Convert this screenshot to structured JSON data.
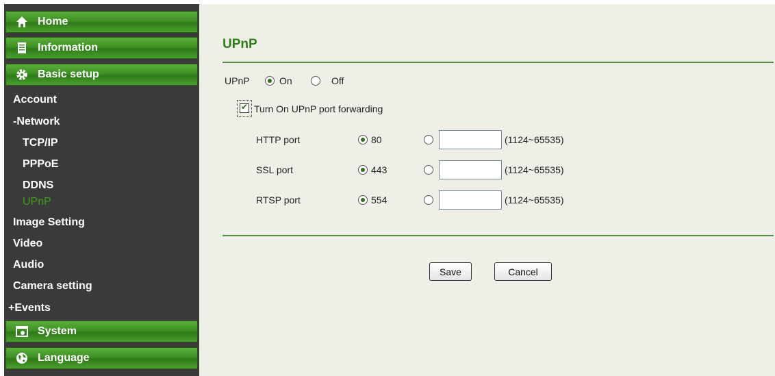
{
  "sidebar": {
    "home": "Home",
    "information": "Information",
    "basic_setup": "Basic setup",
    "items": {
      "account": "Account",
      "network": "-Network",
      "tcpip": "TCP/IP",
      "pppoe": "PPPoE",
      "ddns": "DDNS",
      "upnp": "UPnP",
      "image_setting": "Image Setting",
      "video": "Video",
      "audio": "Audio",
      "camera_setting": "Camera setting",
      "events": "+Events"
    },
    "system": "System",
    "language": "Language",
    "icons": {
      "home": "home-icon",
      "information": "document-icon",
      "basic_setup": "gear-icon",
      "system": "window-icon",
      "language": "globe-icon"
    }
  },
  "main": {
    "title": "UPnP",
    "upnp_label": "UPnP",
    "on_label": "On",
    "off_label": "Off",
    "upnp_enabled": true,
    "port_forwarding_label": "Turn On UPnP port forwarding",
    "port_forwarding_checked": true,
    "ports": [
      {
        "label": "HTTP port",
        "default": "80",
        "range": "(1124~65535)",
        "custom_value": ""
      },
      {
        "label": "SSL port",
        "default": "443",
        "range": "(1124~65535)",
        "custom_value": ""
      },
      {
        "label": "RTSP port",
        "default": "554",
        "range": "(1124~65535)",
        "custom_value": ""
      }
    ],
    "save_label": "Save",
    "cancel_label": "Cancel"
  },
  "colors": {
    "accent_green": "#2e7d1a",
    "sidebar_bg": "#3a3a3a",
    "content_bg": "#eef0e8"
  }
}
